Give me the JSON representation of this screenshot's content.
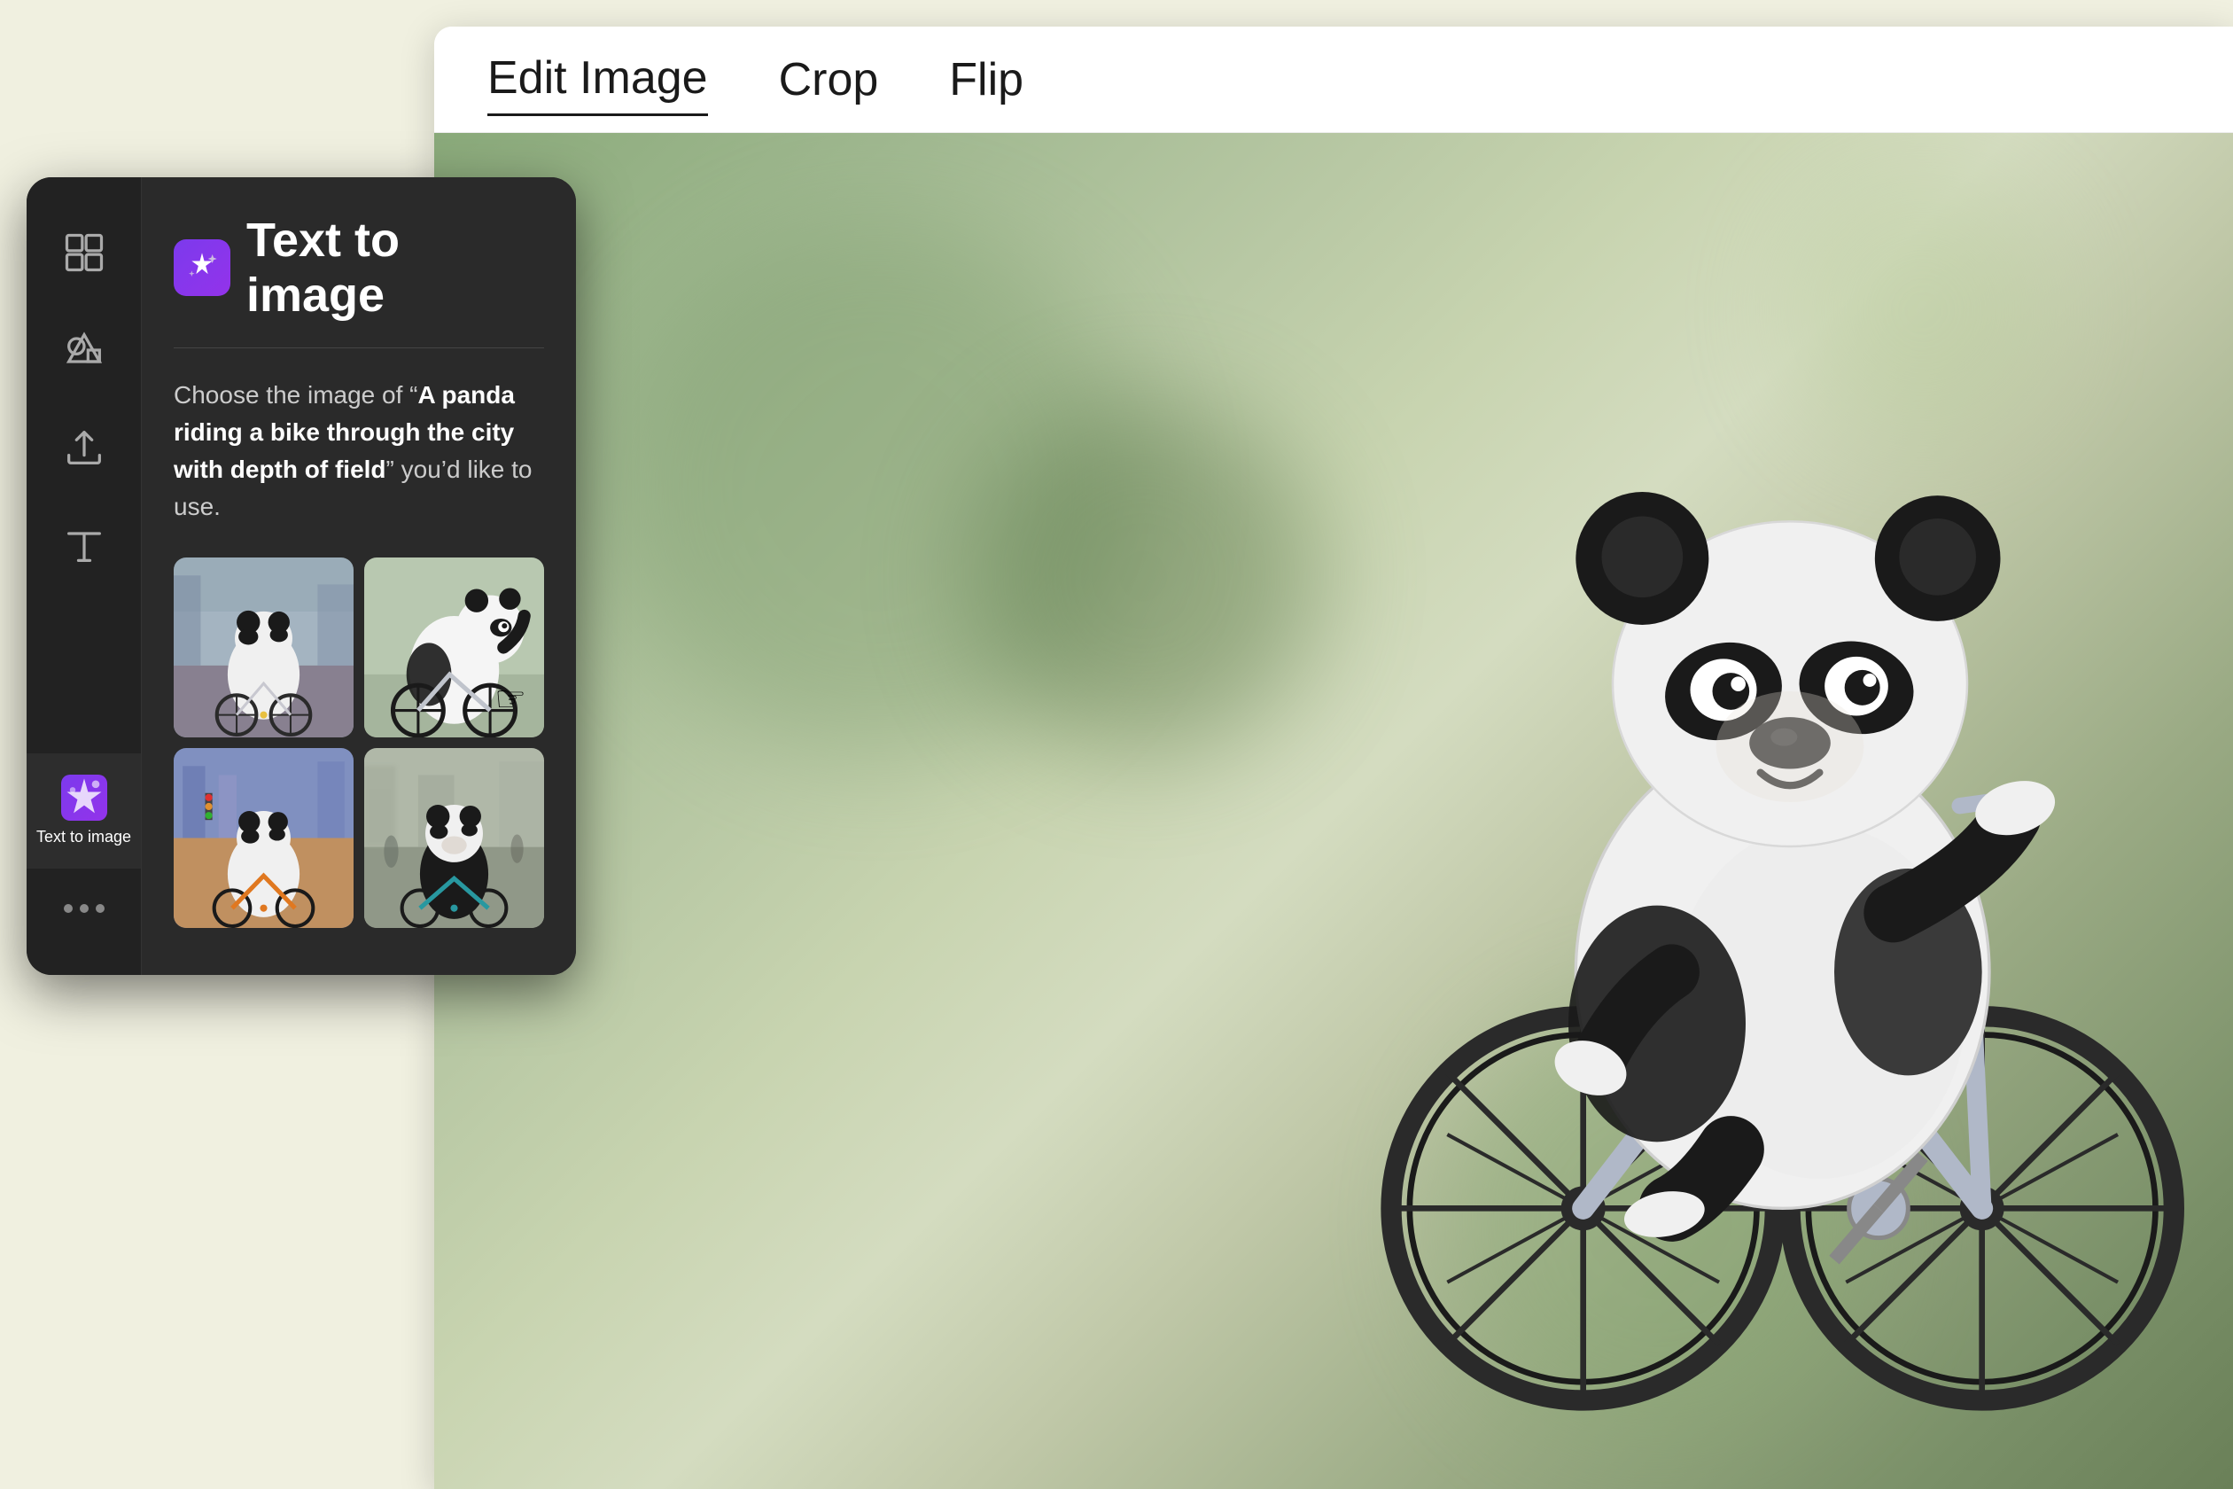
{
  "app": {
    "background_color": "#f5f5e8"
  },
  "toolbar": {
    "edit_image_label": "Edit Image",
    "crop_label": "Crop",
    "flip_label": "Flip",
    "active_tab": "edit_image"
  },
  "sidebar": {
    "icons": [
      {
        "name": "layout-icon",
        "symbol": "layout",
        "label": "",
        "active": false
      },
      {
        "name": "shapes-icon",
        "symbol": "shapes",
        "label": "",
        "active": false
      },
      {
        "name": "upload-icon",
        "symbol": "upload",
        "label": "",
        "active": false
      },
      {
        "name": "text-icon",
        "symbol": "text",
        "label": "",
        "active": false
      },
      {
        "name": "text-to-image-icon",
        "symbol": "tti",
        "label": "Text to image",
        "active": true
      }
    ],
    "more_label": "..."
  },
  "tti_panel": {
    "title": "Text to image",
    "description_prefix": "Choose the image of “",
    "prompt": "A panda riding a bike through the city with depth of field",
    "description_suffix": "” you’d like to use.",
    "images": [
      {
        "id": 1,
        "alt": "Panda riding bike on city street, front view"
      },
      {
        "id": 2,
        "alt": "Panda riding bike, side profile on clean background"
      },
      {
        "id": 3,
        "alt": "Panda riding orange bike in colorful city"
      },
      {
        "id": 4,
        "alt": "Panda riding bike in blurred city scene"
      }
    ]
  },
  "main_image": {
    "alt": "AI generated panda riding a bicycle, close-up with depth of field"
  }
}
